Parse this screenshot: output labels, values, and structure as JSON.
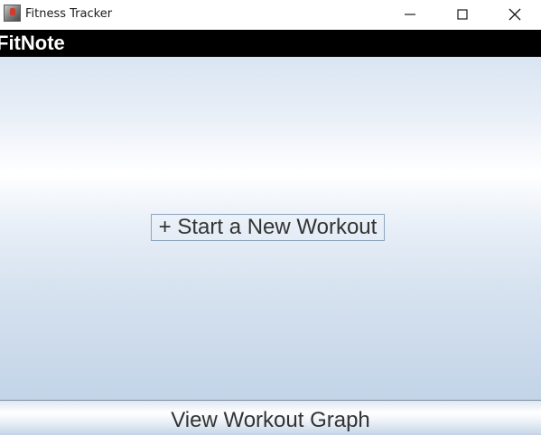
{
  "window": {
    "title": "Fitness Tracker",
    "icon": "java-app-icon",
    "controls": {
      "minimize_icon": "minimize-icon",
      "maximize_icon": "maximize-icon",
      "close_icon": "close-icon"
    }
  },
  "header": {
    "app_name": "FitNote",
    "background": "#000000",
    "text_color": "#ffffff"
  },
  "main": {
    "start_workout_label": "+ Start a New Workout"
  },
  "footer": {
    "graph_button_label": "View Workout Graph"
  },
  "colors": {
    "text": "#333333",
    "panel_gradient_top": "#d9e5f2",
    "panel_gradient_mid": "#ffffff",
    "panel_gradient_bottom": "#c3d4e8",
    "button_border": "#8fa6bd"
  }
}
